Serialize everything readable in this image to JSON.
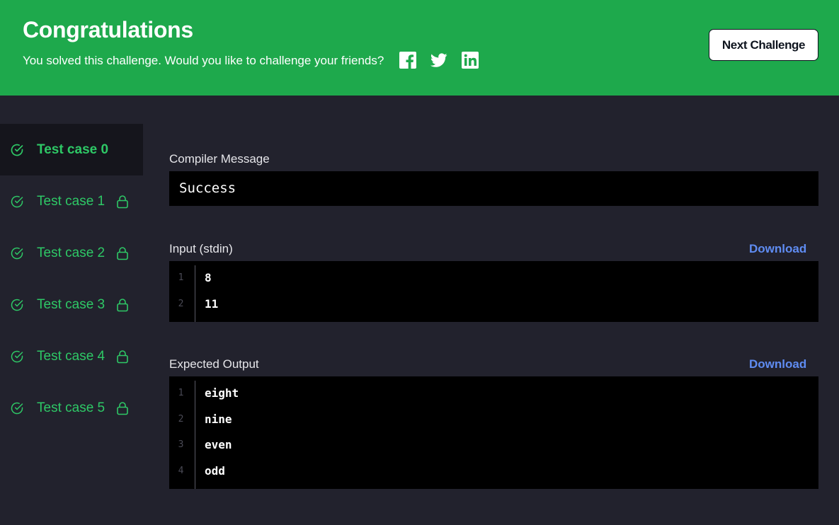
{
  "banner": {
    "title": "Congratulations",
    "subtitle": "You solved this challenge. Would you like to challenge your friends?",
    "social": [
      "facebook-icon",
      "twitter-icon",
      "linkedin-icon"
    ],
    "next_button": "Next Challenge",
    "bg_color": "#1ea94c"
  },
  "sidebar": {
    "items": [
      {
        "label": "Test case 0",
        "active": true,
        "locked": false
      },
      {
        "label": "Test case 1",
        "active": false,
        "locked": true
      },
      {
        "label": "Test case 2",
        "active": false,
        "locked": true
      },
      {
        "label": "Test case 3",
        "active": false,
        "locked": true
      },
      {
        "label": "Test case 4",
        "active": false,
        "locked": true
      },
      {
        "label": "Test case 5",
        "active": false,
        "locked": true
      }
    ],
    "accent_color": "#2ec866"
  },
  "compiler": {
    "label": "Compiler Message",
    "message": "Success"
  },
  "input": {
    "label": "Input (stdin)",
    "download_label": "Download",
    "line_numbers": [
      "1",
      "2"
    ],
    "lines": [
      "8",
      "11"
    ]
  },
  "expected": {
    "label": "Expected Output",
    "download_label": "Download",
    "line_numbers": [
      "1",
      "2",
      "3",
      "4"
    ],
    "lines": [
      "eight",
      "nine",
      "even",
      "odd"
    ]
  },
  "link_color": "#5f8cf2"
}
